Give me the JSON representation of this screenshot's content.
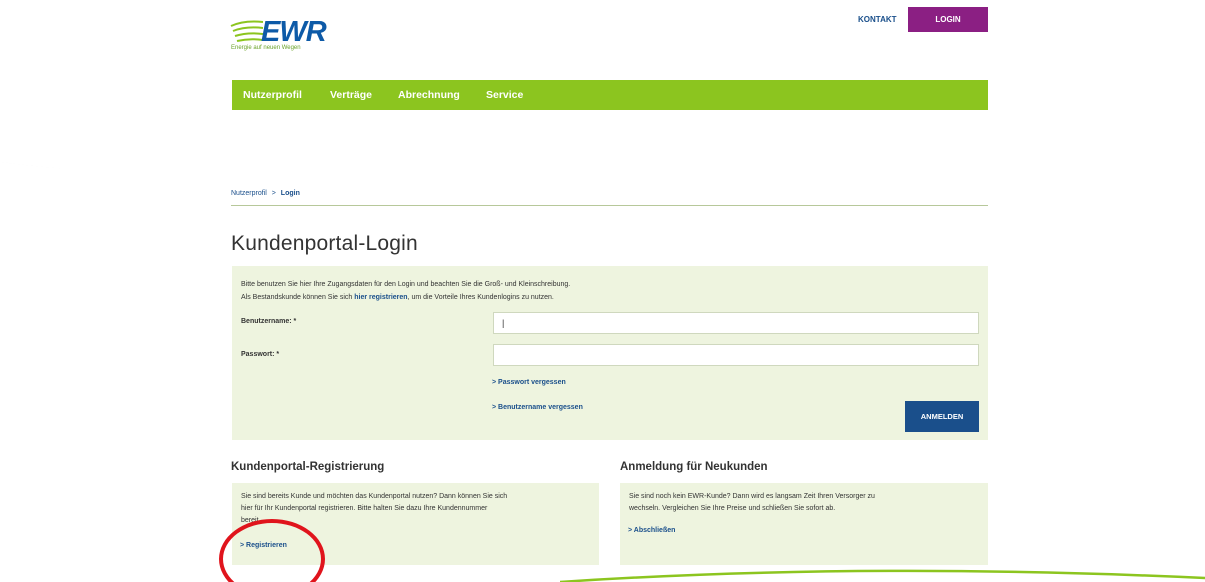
{
  "brand": {
    "logo_text": "EWR",
    "tagline": "Energie auf neuen Wegen",
    "colors": {
      "green": "#8cc51f",
      "blue": "#1a4f8b",
      "purple": "#8b1f83",
      "highlight": "#e0141c"
    }
  },
  "top": {
    "contact": "KONTAKT",
    "login": "LOGIN"
  },
  "nav": {
    "items": [
      "Nutzerprofil",
      "Verträge",
      "Abrechnung",
      "Service"
    ]
  },
  "breadcrumb": {
    "parent": "Nutzerprofil",
    "separator": ">",
    "current": "Login"
  },
  "page": {
    "title": "Kundenportal-Login"
  },
  "login": {
    "intro_line1": "Bitte benutzen Sie hier Ihre Zugangsdaten für den Login und beachten Sie die Groß- und Kleinschreibung.",
    "intro_line2_pre": "Als Bestandskunde können Sie sich ",
    "intro_link": "hier registrieren",
    "intro_line2_post": ", um die Vorteile Ihres Kundenlogins zu nutzen.",
    "username_label": "Benutzername: *",
    "username_value": "|",
    "password_label": "Passwort: *",
    "password_value": "",
    "forgot_password": "> Passwort vergessen",
    "forgot_username": "> Benutzername vergessen",
    "submit": "ANMELDEN"
  },
  "registration": {
    "title": "Kundenportal-Registrierung",
    "text_line1": "Sie sind bereits Kunde und möchten das Kundenportal nutzen? Dann können Sie sich",
    "text_line2": "hier für Ihr Kundenportal registrieren. Bitte halten Sie dazu Ihre Kundennummer",
    "text_line3": "bereit.",
    "link": "> Registrieren"
  },
  "new_customers": {
    "title": "Anmeldung für Neukunden",
    "text_line1": "Sie sind noch kein EWR-Kunde? Dann wird es langsam Zeit Ihren Versorger zu",
    "text_line2": "wechseln. Vergleichen Sie Ihre Preise und schließen Sie sofort ab.",
    "link": "> Abschließen"
  }
}
